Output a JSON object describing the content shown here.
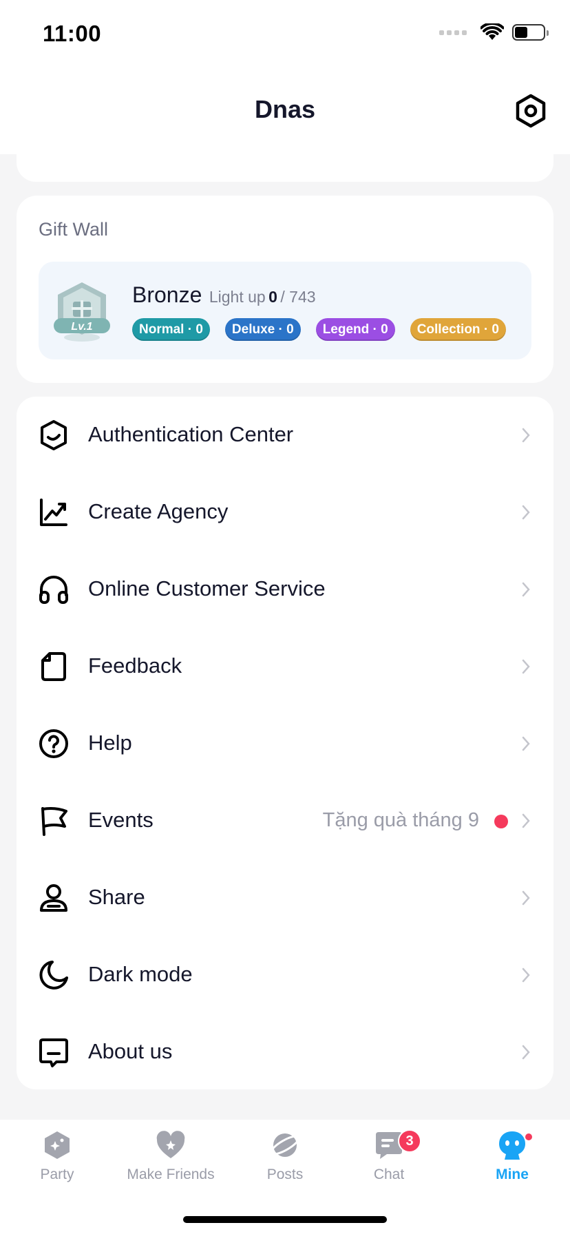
{
  "status_bar": {
    "time": "11:00",
    "battery_level": 0.45
  },
  "header": {
    "title": "Dnas",
    "settings_icon": "settings-icon"
  },
  "gift_wall": {
    "title": "Gift Wall",
    "badge_level": "Lv.1",
    "rank": "Bronze",
    "light_up_label": "Light up",
    "lit_count": "0",
    "total": "/ 743",
    "pills": [
      {
        "label": "Normal · 0",
        "color": "#1f9aa6"
      },
      {
        "label": "Deluxe · 0",
        "color": "#2b74c8"
      },
      {
        "label": "Legend · 0",
        "color": "#9b4ee3"
      },
      {
        "label": "Collection · 0",
        "color": "#e0a53a"
      }
    ]
  },
  "menu": [
    {
      "label": "Authentication Center",
      "icon": "shield-check-icon"
    },
    {
      "label": "Create Agency",
      "icon": "chart-up-icon"
    },
    {
      "label": "Online Customer Service",
      "icon": "headphones-icon"
    },
    {
      "label": "Feedback",
      "icon": "document-icon"
    },
    {
      "label": "Help",
      "icon": "question-icon"
    },
    {
      "label": "Events",
      "icon": "flag-icon",
      "extra": "Tặng quà tháng 9",
      "has_dot": true
    },
    {
      "label": "Share",
      "icon": "person-icon"
    },
    {
      "label": "Dark mode",
      "icon": "moon-icon"
    },
    {
      "label": "About us",
      "icon": "message-icon"
    }
  ],
  "tabs": [
    {
      "label": "Party",
      "icon": "party-icon"
    },
    {
      "label": "Make Friends",
      "icon": "heart-icon"
    },
    {
      "label": "Posts",
      "icon": "planet-icon"
    },
    {
      "label": "Chat",
      "icon": "chat-icon",
      "badge": "3"
    },
    {
      "label": "Mine",
      "icon": "mine-avatar-icon",
      "active": true
    }
  ],
  "colors": {
    "accent": "#19a4f5",
    "badge_red": "#f53a5c",
    "text_primary": "#15172b",
    "text_muted": "#9a9ca8"
  }
}
